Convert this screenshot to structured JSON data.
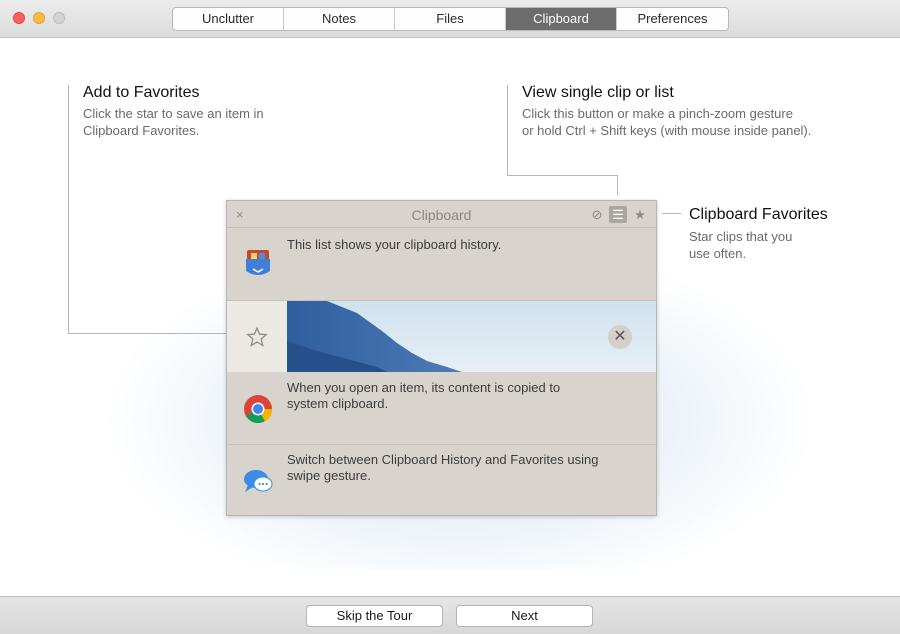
{
  "window": {
    "tabs": [
      {
        "label": "Unclutter",
        "active": false
      },
      {
        "label": "Notes",
        "active": false
      },
      {
        "label": "Files",
        "active": false
      },
      {
        "label": "Clipboard",
        "active": true
      },
      {
        "label": "Preferences",
        "active": false
      }
    ]
  },
  "callouts": {
    "favorites_add": {
      "title": "Add to Favorites",
      "line1": "Click the star to save an item in",
      "line2": "Clipboard Favorites."
    },
    "view_clip": {
      "title": "View single clip or list",
      "line1": "Click this button or make a pinch-zoom gesture",
      "line2": "or hold Ctrl + Shift keys (with mouse inside panel)."
    },
    "clipboard_favorites": {
      "title": "Clipboard Favorites",
      "line1": "Star clips that you",
      "line2": "use often."
    }
  },
  "panel": {
    "title": "Clipboard",
    "close_glyph": "×",
    "icons": [
      "clear-icon",
      "list-view-icon",
      "favorites-star-icon"
    ],
    "rows": [
      {
        "icon": "pocket-app-icon",
        "line1": "This list shows your clipboard history.",
        "line2": ""
      },
      {
        "icon": "chrome-icon",
        "line1": "When you open an item, its content is copied to",
        "line2": "system clipboard."
      },
      {
        "icon": "messages-icon",
        "line1": "Switch between Clipboard History and Favorites using",
        "line2": "swipe gesture."
      }
    ],
    "image_row": {
      "star_icon": "star-outline-icon",
      "remove_glyph": "✕"
    }
  },
  "footer": {
    "skip_label": "Skip the Tour",
    "next_label": "Next"
  },
  "colors": {
    "active_tab": "#6c6c6c",
    "panel_bg": "#d8d4cd",
    "traffic_red": "#fc605c",
    "traffic_yellow": "#fdbc40"
  }
}
